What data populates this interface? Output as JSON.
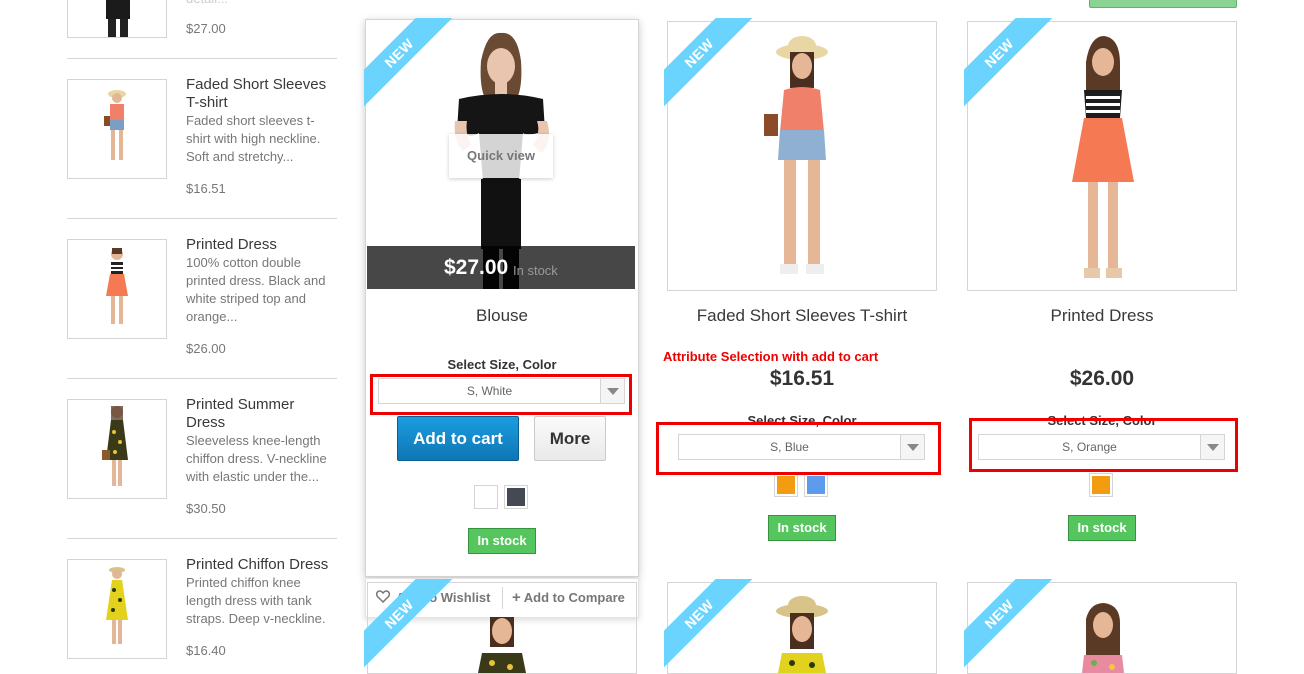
{
  "sidebar": {
    "items": [
      {
        "name": "",
        "desc": "detail...",
        "price": "$27.00"
      },
      {
        "name": "Faded Short Sleeves T-shirt",
        "desc": "Faded short sleeves t-shirt with high neckline. Soft and stretchy...",
        "price": "$16.51"
      },
      {
        "name": "Printed Dress",
        "desc": "100% cotton double printed dress. Black and white striped top and orange...",
        "price": "$26.00"
      },
      {
        "name": "Printed Summer Dress",
        "desc": "Sleeveless knee-length chiffon dress. V-neckline with elastic under the...",
        "price": "$30.50"
      },
      {
        "name": "Printed Chiffon Dress",
        "desc": "Printed chiffon knee length dress with tank straps. Deep v-neckline.",
        "price": "$16.40"
      }
    ]
  },
  "products": [
    {
      "badge": "NEW",
      "name": "Blouse",
      "price": "$27.00",
      "availability_overlay": "In stock",
      "quick_view": "Quick view",
      "select_label": "Select Size, Color",
      "select_value": "S, White",
      "add_to_cart": "Add to cart",
      "more": "More",
      "swatches": [
        "#ffffff",
        "#434a54"
      ],
      "stock": "In stock",
      "wishlist": "Add to Wishlist",
      "compare": "Add to Compare"
    },
    {
      "badge": "NEW",
      "name": "Faded Short Sleeves T-shirt",
      "price": "$16.51",
      "select_label": "Select Size, Color",
      "select_value": "S, Blue",
      "swatches": [
        "#f39c11",
        "#5d9cec"
      ],
      "stock": "In stock"
    },
    {
      "badge": "NEW",
      "name": "Printed Dress",
      "price": "$26.00",
      "select_label": "Select Size, Color",
      "select_value": "S, Orange",
      "swatches": [
        "#f39c11"
      ],
      "stock": "In stock"
    }
  ],
  "bottom_row_badges": [
    "NEW",
    "NEW",
    "NEW"
  ],
  "annotation": "Attribute Selection with add to cart",
  "colors": {
    "ribbon": "#6ad4ff",
    "stock_green": "#55c65e",
    "cart_blue": "#1a86c7",
    "annotation_red": "#e00000"
  }
}
